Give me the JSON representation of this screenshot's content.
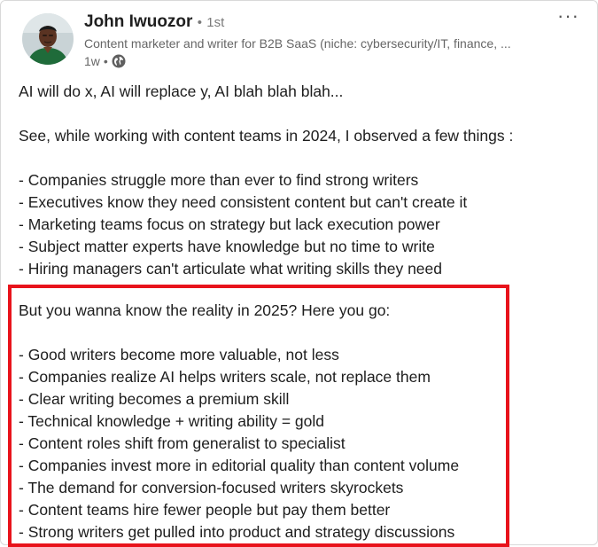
{
  "post": {
    "author": {
      "name": "John Iwuozor",
      "separator": "•",
      "degree": "1st",
      "headline": "Content marketer and writer for B2B SaaS (niche: cybersecurity/IT, finance, ...",
      "time": "1w",
      "visibility_icon": "globe-icon"
    },
    "menu_icon": "more-options-icon",
    "menu_label": "···",
    "intro": [
      "AI will do x, AI will replace y, AI blah blah blah...",
      "",
      "See, while working with content teams in 2024, I observed a few things :",
      "",
      "- Companies struggle more than ever to find strong writers",
      "- Executives know they need consistent content but can't create it",
      "- Marketing teams focus on strategy but lack execution power",
      "- Subject matter experts have knowledge but no time to write",
      "- Hiring managers can't articulate what writing skills they need"
    ],
    "highlighted": [
      "But you wanna know the reality in 2025? Here you go:",
      "",
      "- Good writers become more valuable, not less",
      "- Companies realize AI helps writers scale, not replace them",
      "- Clear writing becomes a premium skill",
      "- Technical knowledge + writing ability = gold",
      "- Content roles shift from generalist to specialist",
      "- Companies invest more in editorial quality than content volume",
      "- The demand for conversion-focused writers skyrockets",
      "- Content teams hire fewer people but pay them better",
      "- Strong writers get pulled into product and strategy discussions"
    ],
    "highlight_color": "#e8131b"
  }
}
